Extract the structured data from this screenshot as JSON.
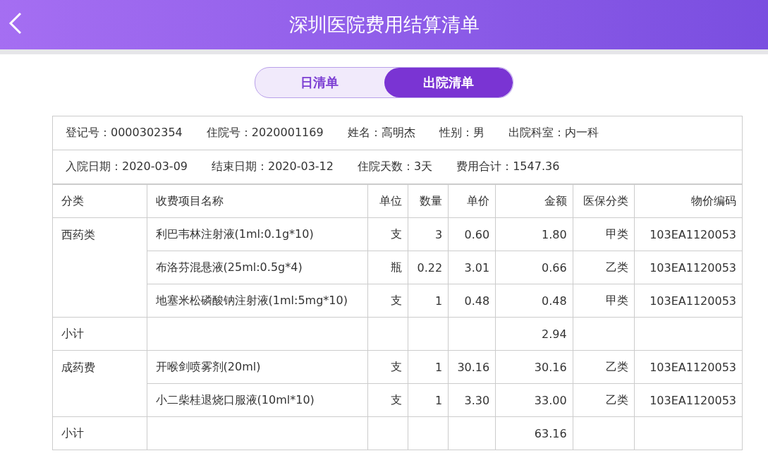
{
  "header": {
    "title": "深圳医院费用结算清单"
  },
  "tabs": [
    {
      "label": "日清单",
      "selected": false
    },
    {
      "label": "出院清单",
      "selected": true
    }
  ],
  "info_rows": [
    [
      {
        "label": "登记号：",
        "value": "0000302354"
      },
      {
        "label": "住院号：",
        "value": "2020001169"
      },
      {
        "label": "姓名：",
        "value": "高明杰"
      },
      {
        "label": "性别：",
        "value": "男"
      },
      {
        "label": "出院科室：",
        "value": "内一科"
      }
    ],
    [
      {
        "label": "入院日期：",
        "value": "2020-03-09"
      },
      {
        "label": "结束日期：",
        "value": "2020-03-12"
      },
      {
        "label": "住院天数：",
        "value": "3天"
      },
      {
        "label": "费用合计：",
        "value": "1547.36"
      }
    ]
  ],
  "table": {
    "columns": [
      "分类",
      "收费项目名称",
      "单位",
      "数量",
      "单价",
      "金额",
      "医保分类",
      "物价编码"
    ],
    "groups": [
      {
        "category": "西药类",
        "rows": [
          [
            "利巴韦林注射液(1ml:0.1g*10)",
            "支",
            "3",
            "0.60",
            "1.80",
            "甲类",
            "103EA1120053"
          ],
          [
            "布洛芬混悬液(25ml:0.5g*4)",
            "瓶",
            "0.22",
            "3.01",
            "0.66",
            "乙类",
            "103EA1120053"
          ],
          [
            "地塞米松磷酸钠注射液(1ml:5mg*10)",
            "支",
            "1",
            "0.48",
            "0.48",
            "甲类",
            "103EA1120053"
          ]
        ],
        "subtotal_label": "小计",
        "subtotal": "2.94"
      },
      {
        "category": "成药费",
        "rows": [
          [
            "开喉剑喷雾剂(20ml)",
            "支",
            "1",
            "30.16",
            "30.16",
            "乙类",
            "103EA1120053"
          ],
          [
            "小二柴桂退烧口服液(10ml*10)",
            "支",
            "1",
            "3.30",
            "33.00",
            "乙类",
            "103EA1120053"
          ]
        ],
        "subtotal_label": "小计",
        "subtotal": "63.16"
      }
    ]
  }
}
